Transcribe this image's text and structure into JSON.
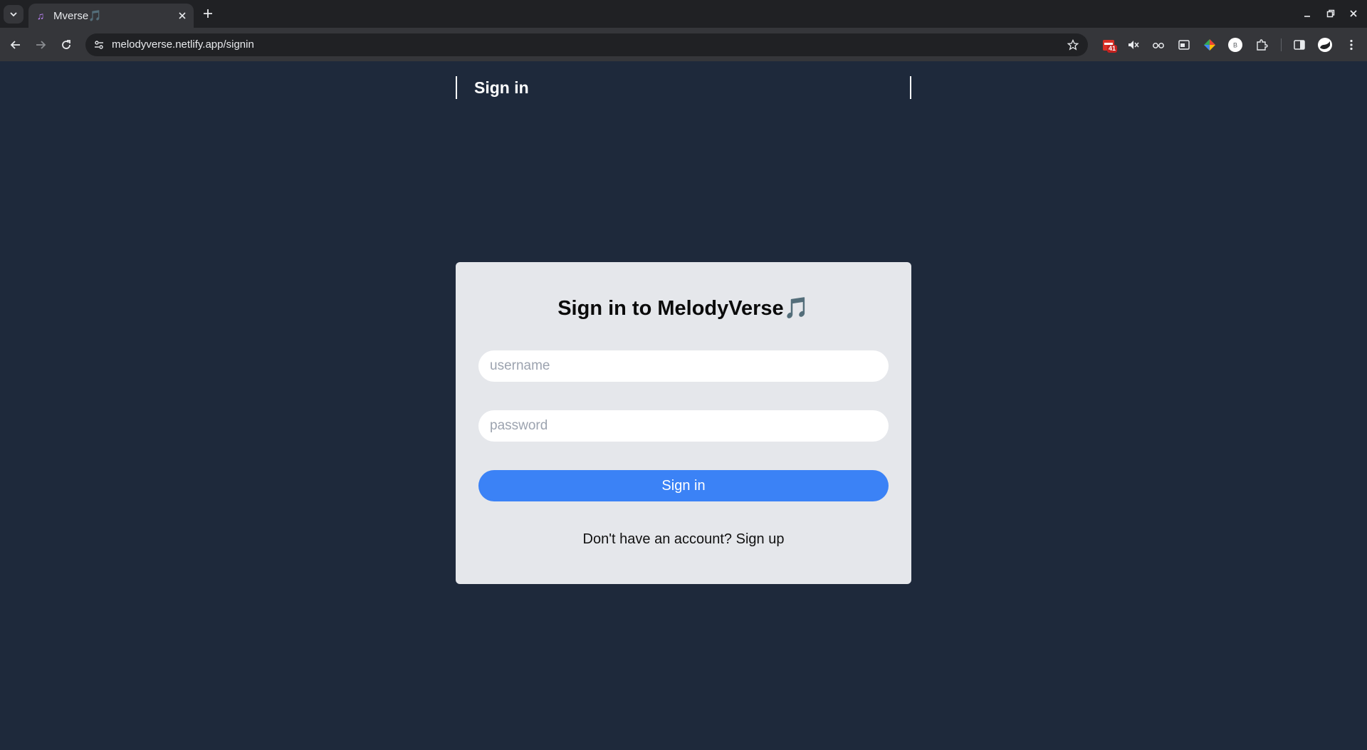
{
  "browser": {
    "tab_title": "Mverse🎵",
    "tab_favicon": "♫",
    "url": "melodyverse.netlify.app/signin",
    "extension_badge": "41",
    "profile_initial": "B"
  },
  "header": {
    "title": "Sign in"
  },
  "form": {
    "title": "Sign in to MelodyVerse",
    "title_emoji": "🎵",
    "username_placeholder": "username",
    "password_placeholder": "password",
    "submit_label": "Sign in",
    "footer_prompt": "Don't have an account?",
    "footer_link": "Sign up"
  },
  "colors": {
    "page_bg": "#1e293b",
    "card_bg": "#e5e7eb",
    "accent": "#3b82f6"
  }
}
